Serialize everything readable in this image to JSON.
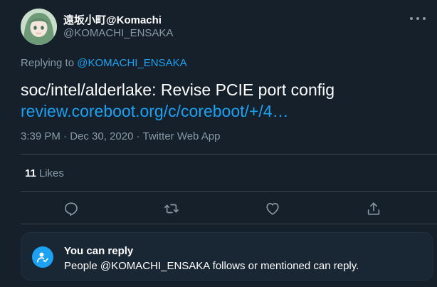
{
  "author": {
    "display_name": "遠坂小町@Komachi",
    "handle": "@KOMACHI_ENSAKA"
  },
  "replying": {
    "prefix": "Replying to ",
    "mention": "@KOMACHI_ENSAKA"
  },
  "tweet": {
    "text": "soc/intel/alderlake: Revise PCIE port config",
    "link": "review.coreboot.org/c/coreboot/+/4…",
    "meta": "3:39 PM · Dec 30, 2020 · Twitter Web App"
  },
  "stats": {
    "likes_count": "11",
    "likes_label": "Likes"
  },
  "actions": {
    "icons": [
      "reply-icon",
      "retweet-icon",
      "like-icon",
      "share-icon"
    ]
  },
  "reply_notice": {
    "title": "You can reply",
    "body": "People @KOMACHI_ENSAKA follows or mentioned can reply."
  },
  "colors": {
    "background": "#15202b",
    "accent": "#1da1f2",
    "secondary_text": "#8899a6",
    "divider": "#38444d"
  }
}
